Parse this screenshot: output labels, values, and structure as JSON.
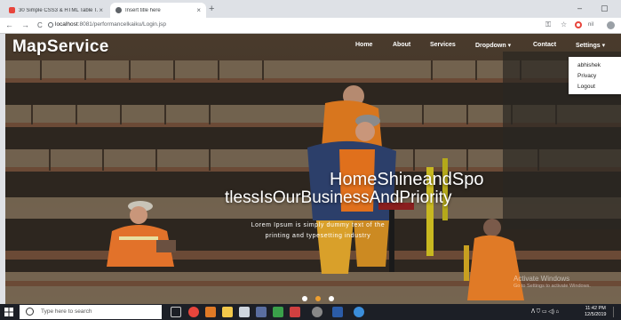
{
  "browser": {
    "tabs": [
      {
        "title": "30 Simple CSS3 & HTML Table T...",
        "close": "×"
      },
      {
        "title": "Insert title here",
        "close": "×"
      }
    ],
    "new_tab": "+",
    "window_controls": {
      "minimize": "–",
      "maximize": "▢"
    },
    "nav": {
      "back": "←",
      "forward": "→",
      "reload": "C"
    },
    "url_host": "localhost",
    "url_path": ":8081/performanceIkaiku/Login.jsp",
    "toolbar_icons": [
      "key-icon",
      "star-icon",
      "opera-icon",
      "extension-icon",
      "profile-icon"
    ]
  },
  "site": {
    "brand": "MapService",
    "nav": {
      "home": "Home",
      "about": "About",
      "services": "Services",
      "dropdown": "Dropdown",
      "contact": "Contact",
      "settings": "Settings"
    },
    "settings_menu": [
      "abhishek",
      "Privacy",
      "Logout"
    ],
    "hero": {
      "line1": "HomeShineandSpo",
      "line2": "tlessIsOurBusinessAndPriority",
      "sub1": "Lorem Ipsum is simply dummy text of the",
      "sub2": "printing and typesetting industry"
    },
    "carousel": {
      "slides": 3,
      "active": 1
    },
    "watermark": {
      "title": "Activate Windows",
      "sub": "Go to Settings to activate Windows."
    }
  },
  "taskbar": {
    "search_placeholder": "Type here to search",
    "tray": "ᐱ  ⛉  ▭  ◁)  ⌂",
    "time": "11:42 PM",
    "date": "12/5/2019"
  },
  "colors": {
    "accent": "#f0a030",
    "taskbar": "#1c1f26",
    "chrome_tabs": "#dee1e6"
  }
}
